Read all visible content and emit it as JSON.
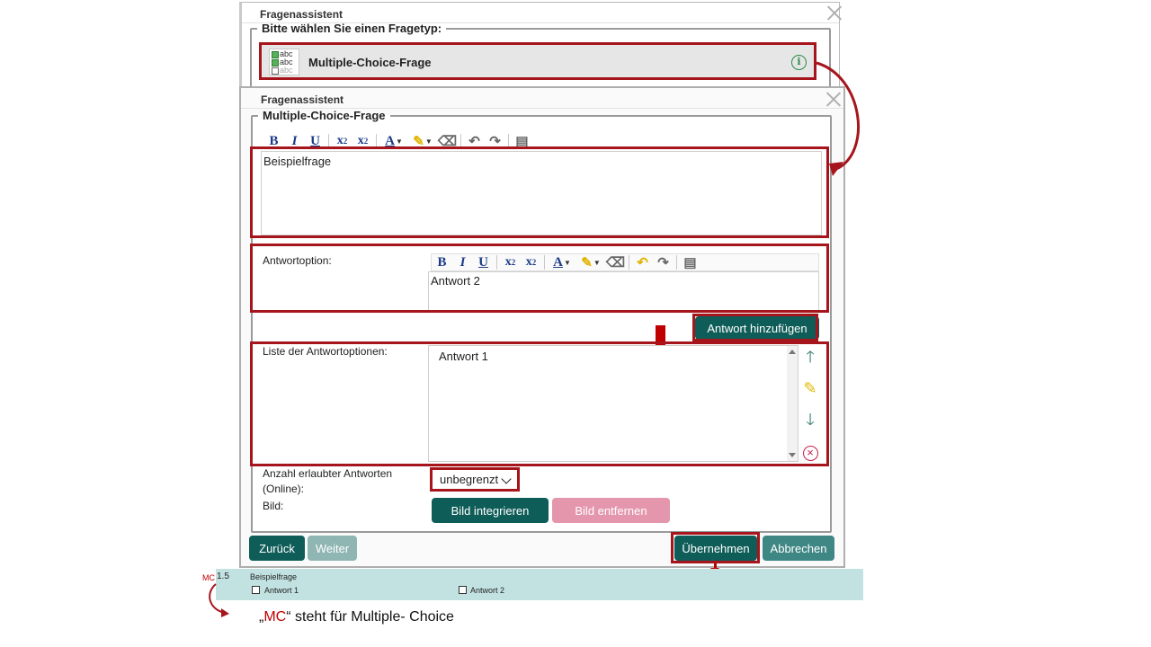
{
  "background_dialog": {
    "title": "Fragenassistent",
    "legend": "Bitte wählen Sie einen Fragetyp:",
    "question_type": {
      "label": "Multiple-Choice-Frage",
      "icon_lines": [
        "abc",
        "abc",
        "abc"
      ],
      "info_icon": "info-icon"
    }
  },
  "main_dialog": {
    "title": "Fragenassistent",
    "legend": "Multiple-Choice-Frage",
    "toolbar": {
      "bold": "B",
      "italic": "I",
      "underline": "U",
      "subscript": "x",
      "subscript_idx": "2",
      "superscript": "x",
      "superscript_idx": "2",
      "font_color": "A",
      "icons": [
        "highlight-icon",
        "eraser-icon",
        "undo-icon",
        "redo-icon",
        "paste-icon"
      ]
    },
    "question_text": "Beispielfrage",
    "answer_option_label": "Antwortoption:",
    "answer_option_value": "Antwort 2",
    "add_answer_button": "Antwort hinzufügen",
    "answer_list_label": "Liste der Antwortoptionen:",
    "answer_list": [
      "Antwort 1"
    ],
    "side_icons": [
      "arrow-up-icon",
      "pencil-icon",
      "arrow-down-icon",
      "delete-icon"
    ],
    "allowed_answers_label_line1": "Anzahl erlaubter Antworten",
    "allowed_answers_label_line2": "(Online):",
    "allowed_answers_value": "unbegrenzt",
    "image_label": "Bild:",
    "insert_image_button": "Bild integrieren",
    "remove_image_button": "Bild entfernen",
    "back_button": "Zurück",
    "next_button": "Weiter",
    "apply_button": "Übernehmen",
    "cancel_button": "Abbrechen"
  },
  "preview": {
    "tag": "MC",
    "points": "1.5",
    "question": "Beispielfrage",
    "answers": [
      "Antwort 1",
      "Antwort 2"
    ]
  },
  "caption": {
    "open_quote": "„",
    "highlight": "MC",
    "rest": "“ steht für Multiple- Choice"
  },
  "colors": {
    "highlight_frame": "#a6151c",
    "primary_button": "#0f5d58",
    "disabled_button": "#8fb6b3",
    "pink_button": "#e496ac",
    "preview_background": "#c2e2e2",
    "caption_highlight": "#c00000"
  }
}
